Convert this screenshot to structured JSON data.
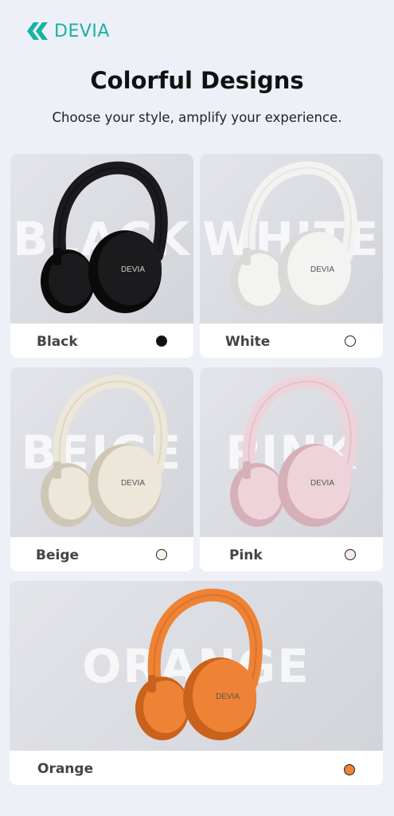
{
  "brand": {
    "name": "DEVIA",
    "color": "#17b3a3"
  },
  "header": {
    "title": "Colorful Designs",
    "subtitle": "Choose your style, amplify your experience."
  },
  "colors": [
    {
      "label": "Black",
      "watermark": "BLACK",
      "swatch": "#111111",
      "body": "#1b1b1d",
      "shade": "#0a0a0b",
      "logo": "DEVIA"
    },
    {
      "label": "White",
      "watermark": "WHITE",
      "swatch": "#ffffff",
      "body": "#f3f3f2",
      "shade": "#d9d9d8",
      "logo": "DEVIA"
    },
    {
      "label": "Beige",
      "watermark": "BEIGE",
      "swatch": "#f5f0e8",
      "body": "#ede7d9",
      "shade": "#cfc7b5",
      "logo": "DEVIA"
    },
    {
      "label": "Pink",
      "watermark": "PINK",
      "swatch": "#f7eaee",
      "body": "#efd3da",
      "shade": "#d5b0b9",
      "logo": "DEVIA"
    },
    {
      "label": "Orange",
      "watermark": "ORANGE",
      "swatch": "#f0833a",
      "body": "#ee8335",
      "shade": "#c9621c",
      "logo": "DEVIA"
    }
  ]
}
